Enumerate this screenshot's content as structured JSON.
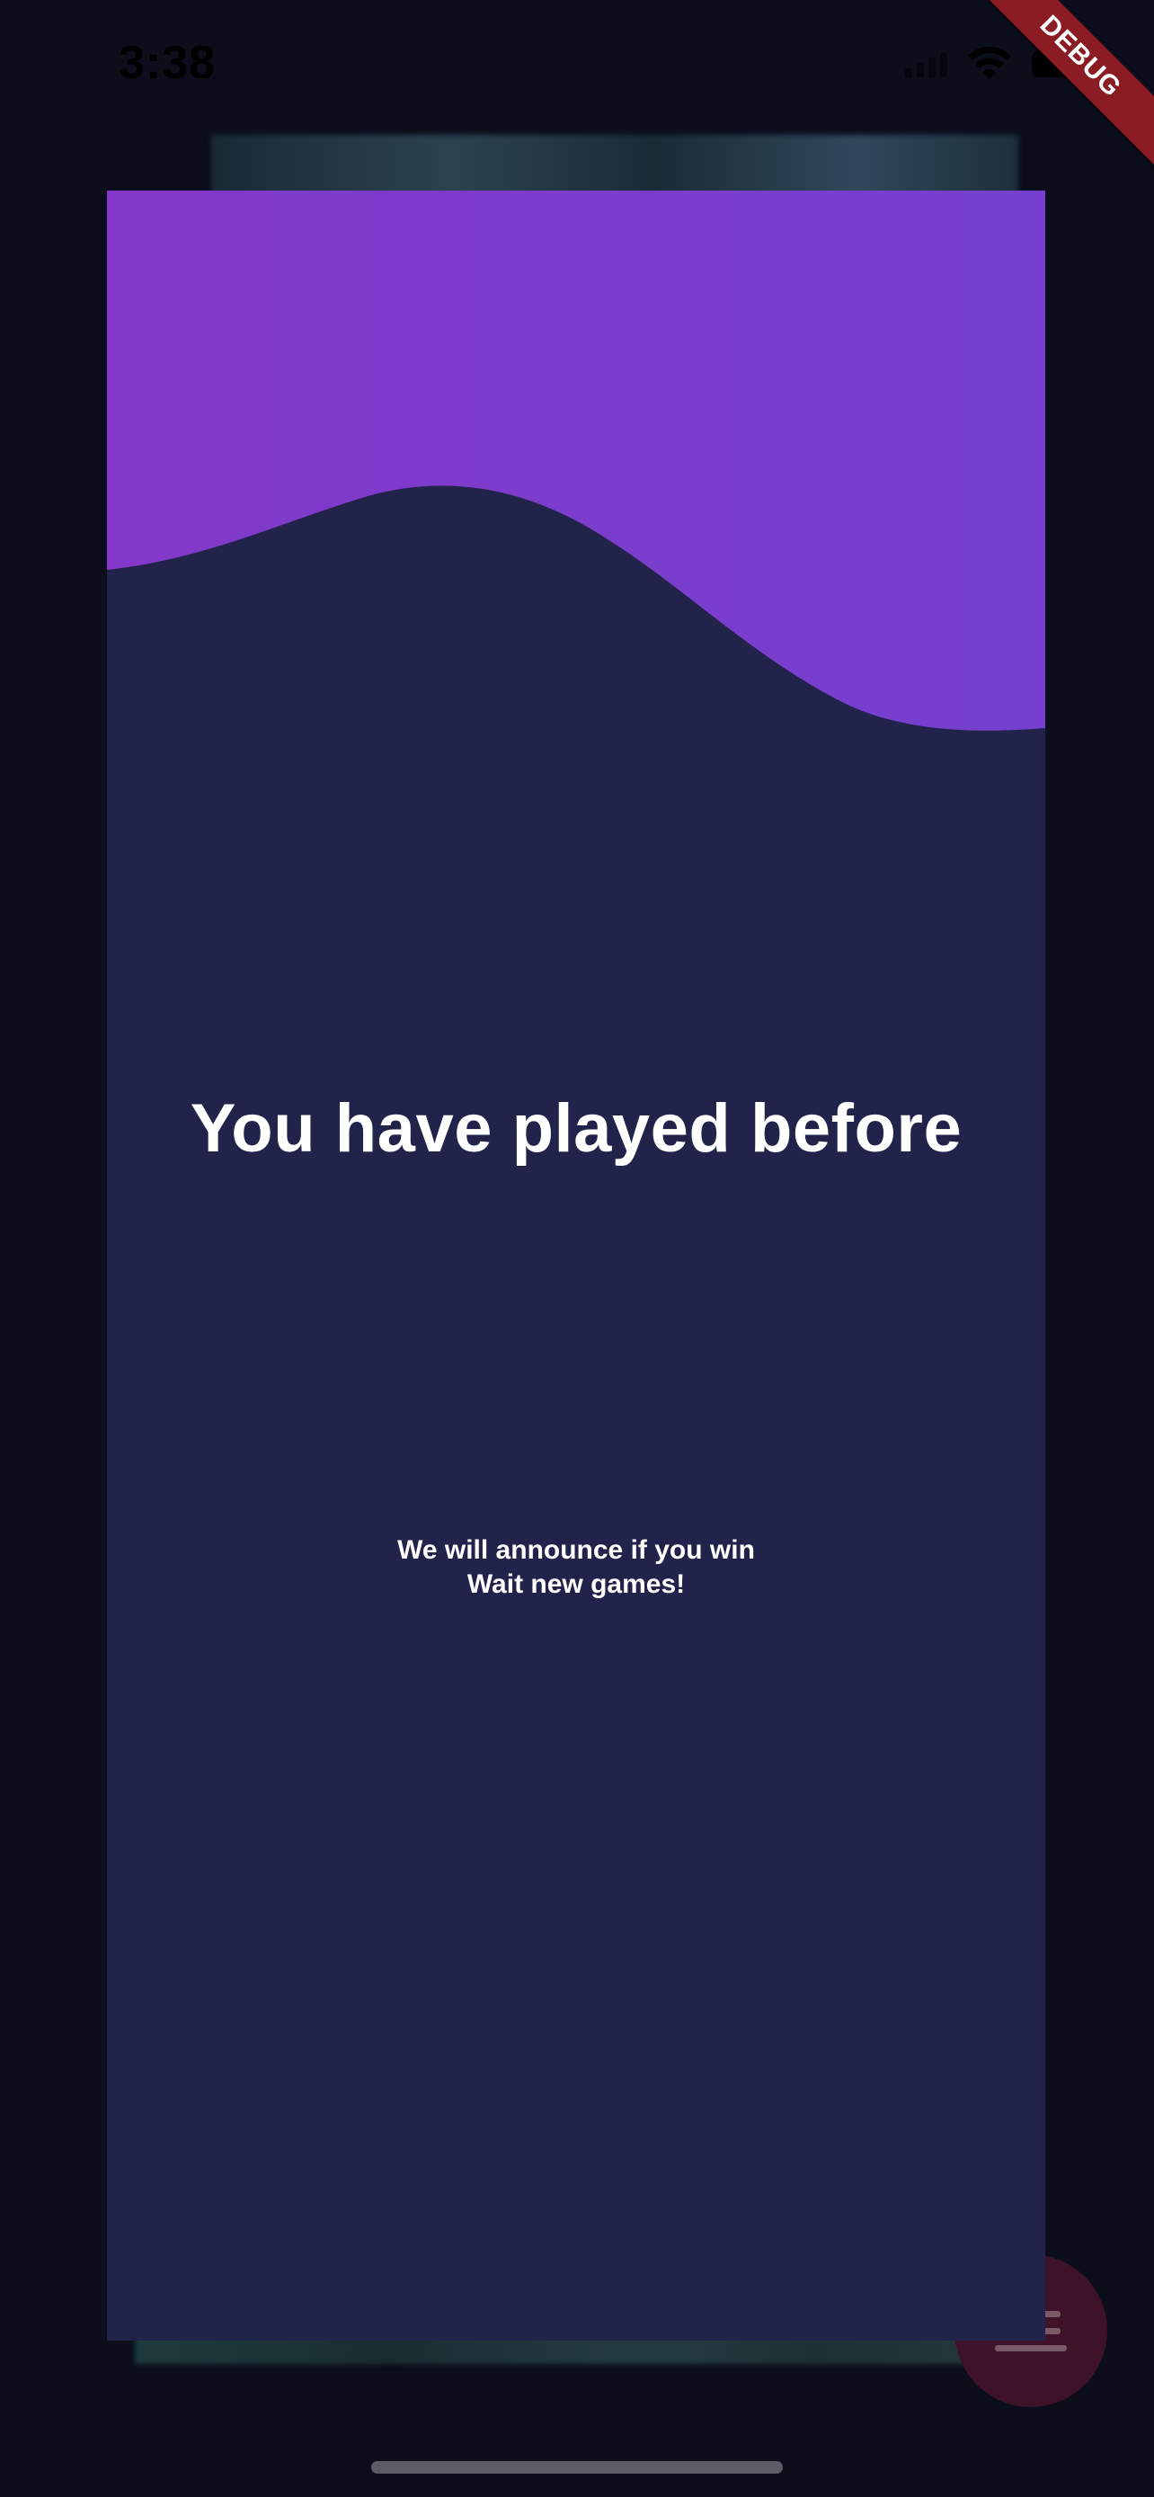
{
  "status_bar": {
    "time": "3:38",
    "icons": [
      "signal-icon",
      "wifi-icon",
      "battery-icon"
    ]
  },
  "debug_banner": {
    "label": "DEBUG",
    "color": "#8c1c23"
  },
  "dialog": {
    "title": "You have played before",
    "message_line_1": "We will announce if you win",
    "message_line_2": "Wait new games!",
    "background_color": "#21234a",
    "wave_colors": [
      "#8338c9",
      "#7540cf"
    ]
  },
  "fab": {
    "icon": "menu-icon",
    "color": "#3e1229"
  }
}
